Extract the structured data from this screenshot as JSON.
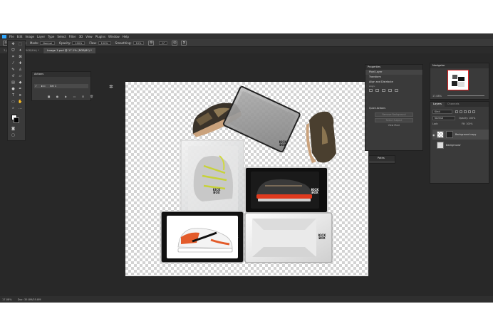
{
  "app": {
    "menu": [
      "File",
      "Edit",
      "Image",
      "Layer",
      "Type",
      "Select",
      "Filter",
      "3D",
      "View",
      "Plugins",
      "Window",
      "Help"
    ],
    "options": {
      "mode_label": "Mode:",
      "mode_value": "Normal",
      "opacity_label": "Opacity:",
      "opacity_value": "100%",
      "flow_label": "Flow:",
      "flow_value": "100%",
      "smoothing_label": "Smoothing:",
      "smoothing_value": "10%",
      "angle_value": "0°"
    },
    "tabs": [
      {
        "label": "3.jpg @ 35.5% (RGB/8#) *",
        "active": false
      },
      {
        "label": "Image 1.psd @ 17.1% (RGB/8*) *",
        "active": true
      }
    ]
  },
  "panels": {
    "actions": {
      "title": "Actions",
      "row_label": "Set 1"
    },
    "properties": {
      "title": "Properties",
      "pixel_layer": "Pixel Layer",
      "transform": "Transform",
      "align": "Align and Distribute",
      "align_sub": "Align:",
      "quick_actions": "Quick Actions",
      "btn_remove": "Remove Background",
      "btn_select": "Select Subject",
      "view_more": "View More"
    },
    "paths": {
      "title": "Paths"
    },
    "navigator": {
      "title": "Navigator",
      "zoom": "17.08%"
    },
    "layers": {
      "tabs": [
        "Layers",
        "Channels"
      ],
      "kind": "Kind",
      "blend": "Normal",
      "opacity_label": "Opacity:",
      "opacity_value": "100%",
      "lock_label": "Lock:",
      "fill_label": "Fill:",
      "fill_value": "100%",
      "rows": [
        "Background copy",
        "Background"
      ]
    }
  },
  "canvas": {
    "brand": "KICK BOX"
  },
  "status": {
    "zoom": "17.08%",
    "doc": "Doc: 35.8M/35.8M"
  },
  "colors": {
    "app_bg": "#282828",
    "panel_bg": "#3a3a3a",
    "accent": "#31a8ff",
    "sole_red": "#e03a1e"
  }
}
